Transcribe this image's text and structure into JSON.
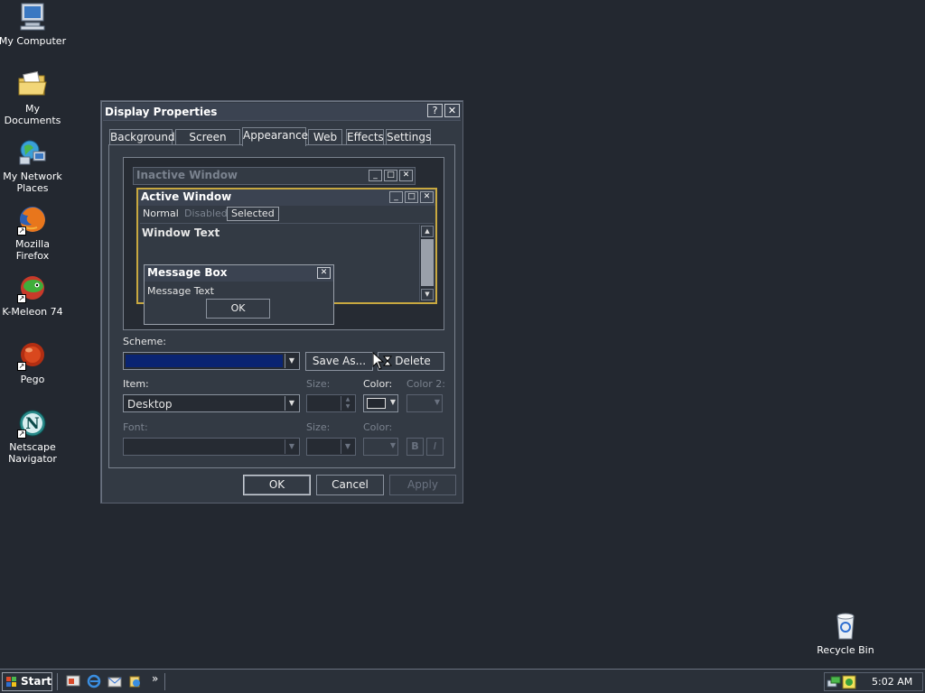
{
  "desktop": {
    "icons": [
      {
        "label": "My Computer",
        "icon": "computer-icon"
      },
      {
        "label": "My Documents",
        "icon": "folder-icon"
      },
      {
        "label": "My Network Places",
        "icon": "network-icon"
      },
      {
        "label": "Mozilla Firefox",
        "icon": "firefox-icon"
      },
      {
        "label": "K-Meleon 74",
        "icon": "kmeleon-icon"
      },
      {
        "label": "Pego",
        "icon": "pego-icon"
      },
      {
        "label": "Netscape Navigator",
        "icon": "netscape-icon"
      },
      {
        "label": "Recycle Bin",
        "icon": "recycle-bin-icon"
      }
    ]
  },
  "dialog": {
    "title": "Display Properties",
    "help_glyph": "?",
    "close_glyph": "✕",
    "tabs": [
      {
        "label": "Background"
      },
      {
        "label": "Screen Saver"
      },
      {
        "label": "Appearance",
        "active": true
      },
      {
        "label": "Web"
      },
      {
        "label": "Effects"
      },
      {
        "label": "Settings"
      }
    ],
    "preview": {
      "inactive_title": "Inactive Window",
      "active_title": "Active Window",
      "menu_normal": "Normal",
      "menu_disabled": "Disabled",
      "menu_selected": "Selected",
      "window_text": "Window Text",
      "msgbox_title": "Message Box",
      "msgbox_text": "Message Text",
      "msgbox_ok": "OK"
    },
    "scheme": {
      "label": "Scheme:",
      "value": "",
      "save_as": "Save As...",
      "delete": "Delete"
    },
    "item": {
      "label": "Item:",
      "value": "Desktop",
      "size_label": "Size:",
      "color_label": "Color:",
      "color2_label": "Color 2:"
    },
    "font": {
      "label": "Font:",
      "size_label": "Size:",
      "color_label": "Color:",
      "bold": "B",
      "italic": "I"
    },
    "buttons": {
      "ok": "OK",
      "cancel": "Cancel",
      "apply": "Apply"
    }
  },
  "taskbar": {
    "start_label": "Start",
    "chevron": "»",
    "clock": "5:02 AM"
  },
  "colors": {
    "desktop": "#232830",
    "scheme_selection": "#0a2472"
  }
}
